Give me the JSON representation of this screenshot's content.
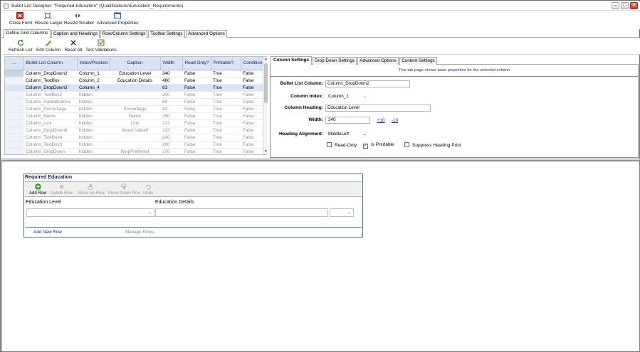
{
  "window": {
    "title": "Bullet List Designer: \"Required Education\" (Qualifications\\Education_Requirements)",
    "controls": [
      "–",
      "□",
      "✕"
    ]
  },
  "ribbon": {
    "close_form": "Close Form",
    "resize_larger": "Resize Larger",
    "resize_smaller": "Resize Smaller",
    "advanced_properties": "Advanced Properties"
  },
  "tabs": {
    "define_grid_columns": "Define Grid Columns",
    "caption_and_headings": "Caption and Headings",
    "row_column_settings": "Row/Column Settings",
    "toolbar_settings": "Toolbar Settings",
    "advanced_options": "Advanced Options"
  },
  "grid_toolbar": {
    "refresh_list": "Refresh List",
    "edit_column": "Edit Column",
    "reset_all": "Reset All",
    "test_validations": "Test Validations"
  },
  "grid": {
    "headers": [
      "...",
      "Bullet List Column",
      "Index/Position",
      "Caption",
      "Width",
      "Read Only?",
      "Printable?",
      "Conditional?"
    ],
    "rows": [
      {
        "column": "Column_DropDown2",
        "index": "Column_1",
        "caption": "Education Level",
        "width": "340",
        "read_only": "False",
        "printable": "True",
        "conditional": "False",
        "state": "current"
      },
      {
        "column": "Column_TextBox",
        "index": "Column_2",
        "caption": "Education Details",
        "width": "460",
        "read_only": "False",
        "printable": "True",
        "conditional": "False",
        "state": "normal"
      },
      {
        "column": "Column_DropDown3",
        "index": "Column_4",
        "caption": "",
        "width": "63",
        "read_only": "False",
        "printable": "True",
        "conditional": "False",
        "state": "selected"
      },
      {
        "column": "Column_TextBox2",
        "index": "hidden",
        "caption": "",
        "width": "200",
        "read_only": "False",
        "printable": "True",
        "conditional": "False",
        "state": "hidden"
      },
      {
        "column": "Column_RadioButtons",
        "index": "hidden",
        "caption": "",
        "width": "69",
        "read_only": "False",
        "printable": "True",
        "conditional": "False",
        "state": "hidden"
      },
      {
        "column": "Column_Percentage",
        "index": "hidden",
        "caption": "Percentage",
        "width": "43",
        "read_only": "False",
        "printable": "True",
        "conditional": "False",
        "state": "hidden"
      },
      {
        "column": "Column_Name",
        "index": "hidden",
        "caption": "Name",
        "width": "250",
        "read_only": "False",
        "printable": "True",
        "conditional": "False",
        "state": "hidden"
      },
      {
        "column": "Column_Link",
        "index": "hidden",
        "caption": "Link",
        "width": "133",
        "read_only": "False",
        "printable": "True",
        "conditional": "False",
        "state": "hidden"
      },
      {
        "column": "Column_DropDown6",
        "index": "hidden",
        "caption": "Select Value6",
        "width": "133",
        "read_only": "False",
        "printable": "True",
        "conditional": "False",
        "state": "hidden"
      },
      {
        "column": "Column_TextBox4",
        "index": "hidden",
        "caption": "",
        "width": "200",
        "read_only": "False",
        "printable": "True",
        "conditional": "False",
        "state": "hidden"
      },
      {
        "column": "Column_TextBox3",
        "index": "hidden",
        "caption": "",
        "width": "200",
        "read_only": "False",
        "printable": "True",
        "conditional": "False",
        "state": "hidden"
      },
      {
        "column": "Column_DropDown",
        "index": "hidden",
        "caption": "Req/Preferred",
        "width": "170",
        "read_only": "False",
        "printable": "True",
        "conditional": "False",
        "state": "hidden"
      }
    ]
  },
  "subtabs": {
    "column_settings": "Column Settings",
    "drop_down_settings": "Drop Down Settings",
    "advanced_options": "Advanced Options",
    "content_settings": "Content Settings"
  },
  "settings": {
    "info": "This tab page shows base properties for the selected column",
    "bullet_list_column_label": "Bullet List Column:",
    "bullet_list_column_value": "Column_DropDown2",
    "column_index_label": "Column Index:",
    "column_index_value": "Column_1",
    "column_heading_label": "Column Heading:",
    "column_heading_value": "Education Level",
    "width_label": "Width:",
    "width_value": "340",
    "width_plus": "+10",
    "width_minus": "-10",
    "heading_alignment_label": "Heading Alignment:",
    "heading_alignment_value": "MiddleLeft",
    "read_only_label": "Read-Only",
    "read_only_checked": false,
    "is_printable_label": "Is Printable",
    "is_printable_checked": true,
    "suppress_heading_print_label": "Suppress Heading Print",
    "suppress_heading_print_checked": false
  },
  "preview": {
    "title": "Required Education",
    "add_row": "Add Row",
    "delete_row": "Delete Row",
    "move_up_row": "Move Up Row",
    "move_down_row": "Move Down Row",
    "undo": "Undo",
    "col1_header": "Education Level",
    "col2_header": "Education Details",
    "add_new_row": "Add New Row",
    "manage_rows": "Manage Rows"
  },
  "colors": {
    "grid_header": "#d8e4f1",
    "selected_row": "#d7e5f5",
    "link": "#1a1aa8",
    "preview_border": "#4f7b6f"
  }
}
